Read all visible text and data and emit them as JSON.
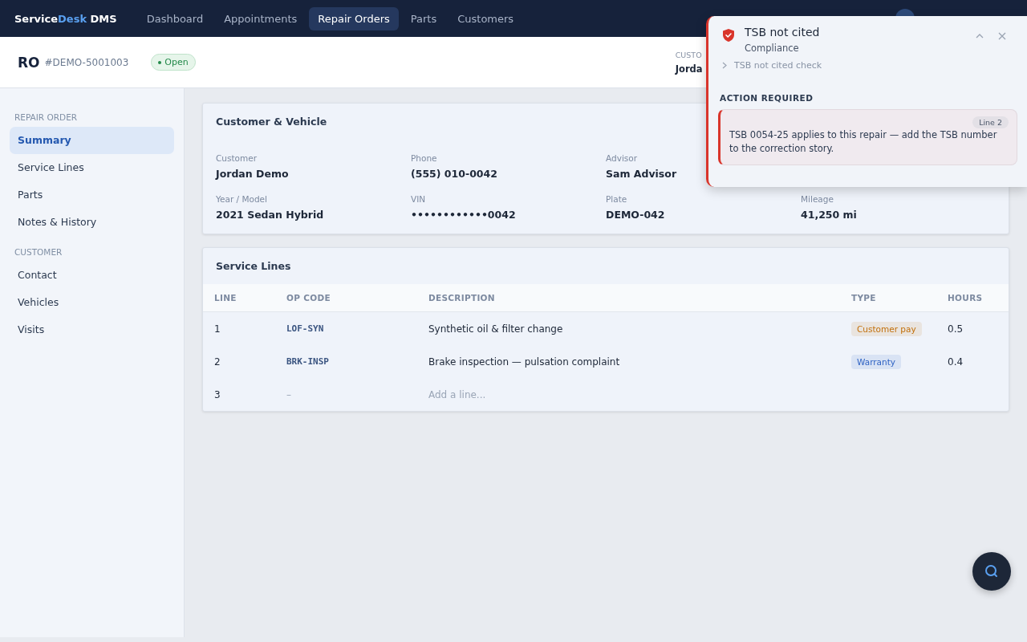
{
  "topbar": {
    "brand": {
      "lead": "Service",
      "accent": "Desk",
      "tail": " DMS"
    },
    "nav": [
      {
        "label": "Dashboard",
        "selected": false
      },
      {
        "label": "Appointments",
        "selected": false
      },
      {
        "label": "Repair Orders",
        "selected": true
      },
      {
        "label": "Parts",
        "selected": false
      },
      {
        "label": "Customers",
        "selected": false
      }
    ]
  },
  "header": {
    "title": "RO",
    "number": "#DEMO-5001003",
    "status": "Open",
    "meta_label": "CUSTO",
    "meta_value": "Jorda"
  },
  "sidebar": {
    "sections": [
      {
        "heading": "REPAIR ORDER",
        "items": [
          {
            "label": "Summary",
            "selected": true
          },
          {
            "label": "Service Lines",
            "selected": false
          },
          {
            "label": "Parts",
            "selected": false
          },
          {
            "label": "Notes & History",
            "selected": false
          }
        ]
      },
      {
        "heading": "CUSTOMER",
        "items": [
          {
            "label": "Contact",
            "selected": false
          },
          {
            "label": "Vehicles",
            "selected": false
          },
          {
            "label": "Visits",
            "selected": false
          }
        ]
      }
    ]
  },
  "vehicle_card": {
    "title": "Customer & Vehicle",
    "rows": [
      [
        {
          "label": "Customer",
          "value": "Jordan Demo"
        },
        {
          "label": "Phone",
          "value": "(555) 010-0042"
        },
        {
          "label": "Advisor",
          "value": "Sam Advisor"
        }
      ],
      [
        {
          "label": "Year / Model",
          "value": "2021 Sedan Hybrid"
        },
        {
          "label": "VIN",
          "value": "••••••••••••0042"
        },
        {
          "label": "Plate",
          "value": "DEMO-042"
        },
        {
          "label": "Mileage",
          "value": "41,250 mi"
        }
      ]
    ]
  },
  "service_lines": {
    "title": "Service Lines",
    "columns": [
      "LINE",
      "OP CODE",
      "DESCRIPTION",
      "TYPE",
      "HOURS"
    ],
    "rows": [
      {
        "kind": "line",
        "line": "1",
        "op_code": "LOF-SYN",
        "description": "Synthetic oil & filter change",
        "type": "Customer pay",
        "color": "#c2700c",
        "hours": "0.5"
      },
      {
        "kind": "line",
        "line": "2",
        "op_code": "BRK-INSP",
        "description": "Brake inspection — pulsation complaint",
        "type": "Warranty",
        "color": "#2f63c4",
        "hours": "0.4"
      },
      {
        "kind": "add",
        "line": "3",
        "op_code": "–",
        "description": "Add a line..."
      }
    ]
  },
  "toast": {
    "title": "TSB not cited",
    "subtitle": "Compliance",
    "check": "TSB not cited check",
    "section": "ACTION REQUIRED",
    "action": {
      "tag": "Line 2",
      "text": "TSB 0054-25 applies to this repair — add the TSB number to the correction story."
    }
  }
}
